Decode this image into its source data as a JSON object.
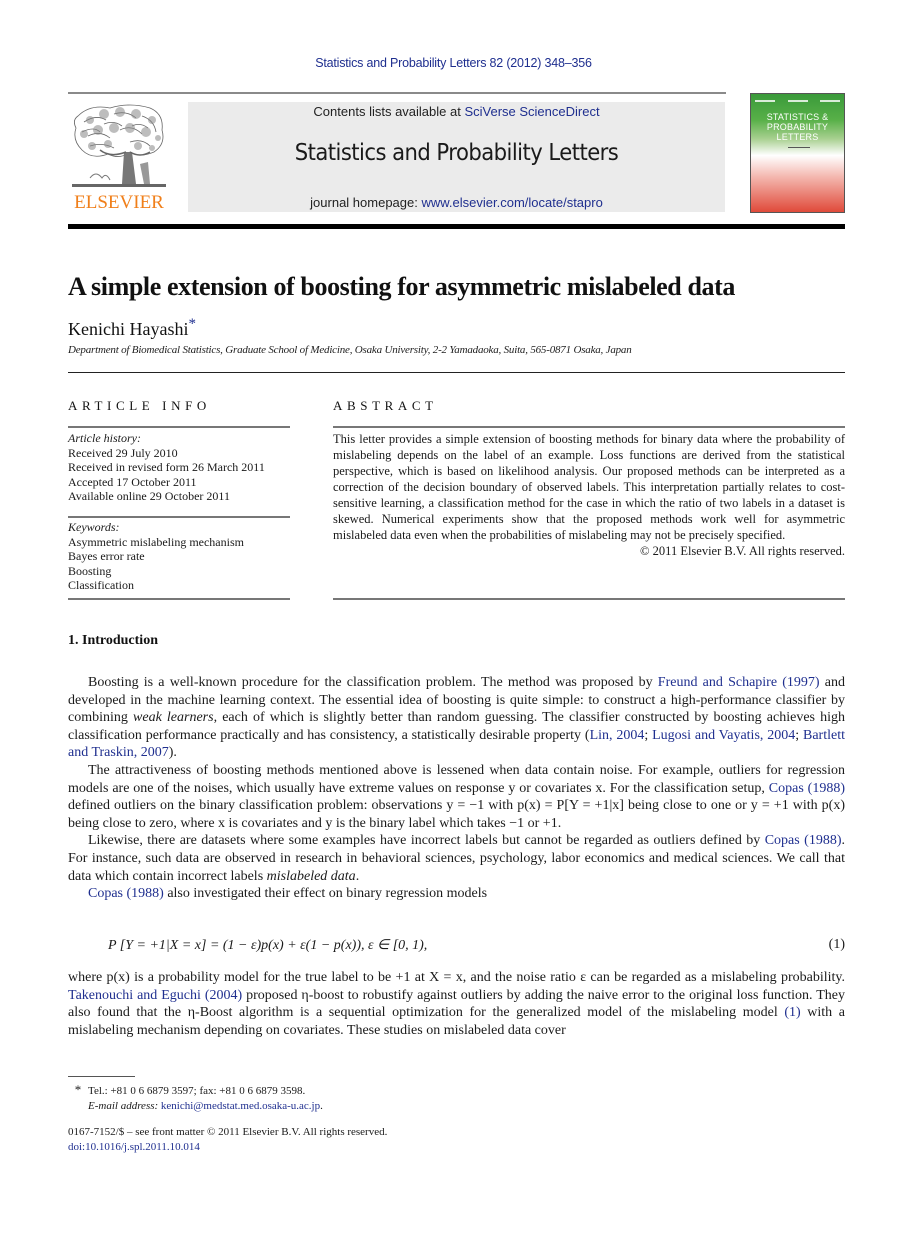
{
  "running_head": "Statistics and Probability Letters 82 (2012) 348–356",
  "masthead": {
    "publisher_logo_text": "ELSEVIER",
    "contents_prefix": "Contents lists available at ",
    "contents_link": "SciVerse ScienceDirect",
    "journal_title": "Statistics and Probability Letters",
    "homepage_prefix": "journal homepage: ",
    "homepage_link": "www.elsevier.com/locate/stapro",
    "cover_title_lines": [
      "STATISTICS &",
      "PROBABILITY",
      "LETTERS"
    ]
  },
  "article": {
    "title": "A simple extension of boosting for asymmetric mislabeled data",
    "author": "Kenichi Hayashi",
    "author_mark": "*",
    "affiliation": "Department of Biomedical Statistics, Graduate School of Medicine, Osaka University, 2-2 Yamadaoka, Suita, 565-0871 Osaka, Japan"
  },
  "article_info": {
    "heading": "ARTICLE INFO",
    "history_label": "Article history:",
    "history": [
      "Received 29 July 2010",
      "Received in revised form 26 March 2011",
      "Accepted 17 October 2011",
      "Available online 29 October 2011"
    ],
    "keywords_label": "Keywords:",
    "keywords": [
      "Asymmetric mislabeling mechanism",
      "Bayes error rate",
      "Boosting",
      "Classification"
    ]
  },
  "abstract": {
    "heading": "ABSTRACT",
    "text": "This letter provides a simple extension of boosting methods for binary data where the probability of mislabeling depends on the label of an example. Loss functions are derived from the statistical perspective, which is based on likelihood analysis. Our proposed methods can be interpreted as a correction of the decision boundary of observed labels. This interpretation partially relates to cost-sensitive learning, a classification method for the case in which the ratio of two labels in a dataset is skewed. Numerical experiments show that the proposed methods work well for asymmetric mislabeled data even when the probabilities of mislabeling may not be precisely specified.",
    "copyright": "© 2011 Elsevier B.V. All rights reserved."
  },
  "intro": {
    "heading": "1.  Introduction",
    "p1": {
      "a": "Boosting is a well-known procedure for the classification problem. The method was proposed by ",
      "link1": "Freund and Schapire (1997)",
      "b": " and developed in the machine learning context. The essential idea of boosting is quite simple: to construct a high-performance classifier by combining ",
      "em": "weak learners",
      "c": ", each of which is slightly better than random guessing. The classifier constructed by boosting achieves high classification performance practically and has consistency, a statistically desirable property (",
      "link2": "Lin, 2004",
      "sep1": "; ",
      "link3": "Lugosi and Vayatis, 2004",
      "sep2": "; ",
      "link4": "Bartlett and Traskin, 2007",
      "d": ")."
    },
    "p2": {
      "a": "The attractiveness of boosting methods mentioned above is lessened when data contain noise. For example, outliers for regression models are one of the noises, which usually have extreme values on response y or covariates x. For the classification setup, ",
      "link1": "Copas (1988)",
      "b": " defined outliers on the binary classification problem: observations y = −1 with p(x) = P[Y = +1|x] being close to one or y = +1 with p(x) being close to zero, where x is covariates and y is the binary label which takes −1 or +1."
    },
    "p3": {
      "a": "Likewise, there are datasets where some examples have incorrect labels but cannot be regarded as outliers defined by ",
      "link1": "Copas (1988)",
      "b": ". For instance, such data are observed in research in behavioral sciences, psychology, labor economics and medical sciences. We call that data which contain incorrect labels ",
      "em": "mislabeled data",
      "c": "."
    },
    "p4": {
      "link1": "Copas (1988)",
      "a": " also investigated their effect on binary regression models"
    },
    "equation": {
      "text": "P [Y = +1|X = x] = (1 − ε)p(x) + ε(1 − p(x)),     ε ∈ [0, 1),",
      "number": "(1)"
    },
    "p5": {
      "a": "where p(x) is a probability model for the true label to be +1 at X = x, and the noise ratio ε can be regarded as a mislabeling probability. ",
      "link1": "Takenouchi and Eguchi (2004)",
      "b": " proposed η-boost to robustify against outliers by adding the naive error to the original loss function. They also found that the η-Boost algorithm is a sequential optimization for the generalized model of the mislabeling model ",
      "link2": "(1)",
      "c": " with a mislabeling mechanism depending on covariates. These studies on mislabeled data cover"
    }
  },
  "footnotes": {
    "mark": "*",
    "contact": "Tel.: +81 0 6 6879 3597; fax: +81 0 6 6879 3598.",
    "email_label": "E-mail address: ",
    "email": "kenichi@medstat.med.osaka-u.ac.jp",
    "email_end": "."
  },
  "front_matter": {
    "issn_line": "0167-7152/$ – see front matter © 2011 Elsevier B.V. All rights reserved.",
    "doi": "doi:10.1016/j.spl.2011.10.014"
  },
  "colors": {
    "link": "#1f2f8f",
    "elsevier_orange": "#f07f1a",
    "masthead_bg": "#ebebeb"
  }
}
